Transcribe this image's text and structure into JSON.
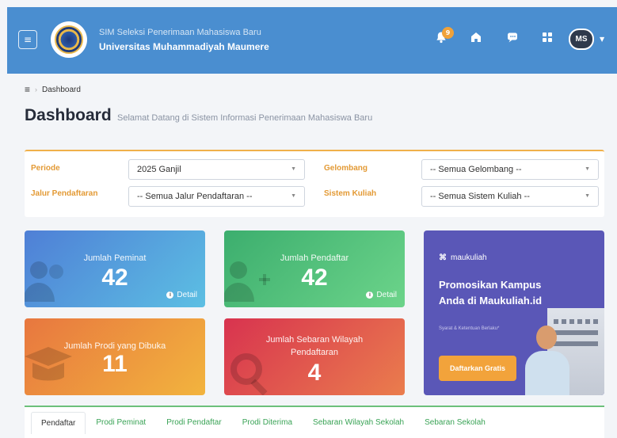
{
  "header": {
    "app_subtitle": "SIM Seleksi Penerimaan Mahasiswa Baru",
    "app_title": "Universitas Muhammadiyah Maumere",
    "notification_count": "9",
    "user_initials": "MS",
    "icons": [
      "menu-icon",
      "bell-icon",
      "home-icon",
      "chat-icon",
      "grid-icon",
      "avatar"
    ]
  },
  "breadcrumb": {
    "item": "Dashboard"
  },
  "page": {
    "title": "Dashboard",
    "subtitle": "Selamat Datang di Sistem Informasi Penerimaan Mahasiswa Baru"
  },
  "filters": {
    "periode_label": "Periode",
    "periode_value": "2025 Ganjil",
    "gelombang_label": "Gelombang",
    "gelombang_value": "-- Semua Gelombang --",
    "jalur_label": "Jalur Pendaftaran",
    "jalur_value": "-- Semua Jalur Pendaftaran --",
    "sistem_label": "Sistem Kuliah",
    "sistem_value": "-- Semua Sistem Kuliah --"
  },
  "stats": {
    "peminat": {
      "label": "Jumlah Peminat",
      "value": "42",
      "detail": "Detail"
    },
    "pendaftar": {
      "label": "Jumlah Pendaftar",
      "value": "42",
      "detail": "Detail"
    },
    "prodi": {
      "label": "Jumlah Prodi yang Dibuka",
      "value": "11"
    },
    "wilayah": {
      "label": "Jumlah Sebaran Wilayah Pendaftaran",
      "value": "4"
    }
  },
  "promo": {
    "brand": "maukuliah",
    "headline": "Promosikan Kampus Anda di Maukuliah.id",
    "fine_print": "Syarat & Ketentuan Berlaku*",
    "button": "Daftarkan Gratis"
  },
  "tabs": [
    "Pendaftar",
    "Prodi Peminat",
    "Prodi Pendaftar",
    "Prodi Diterima",
    "Sebaran Wilayah Sekolah",
    "Sebaran Sekolah"
  ],
  "colors": {
    "topbar": "#4a8ed0",
    "accent_orange": "#f0b04a",
    "tab_green": "#3aa356",
    "promo_purple": "#5a57b7"
  }
}
